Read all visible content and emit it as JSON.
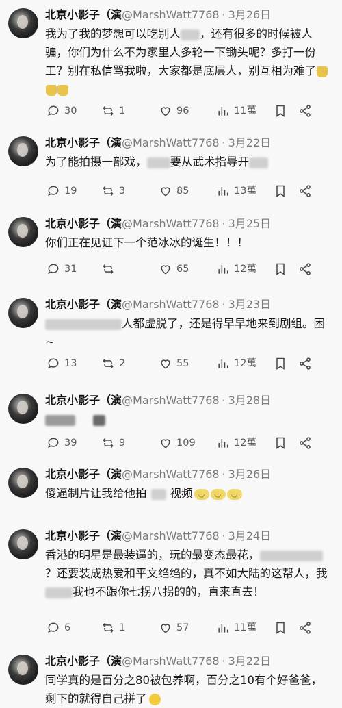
{
  "posts": [
    {
      "name": "北京小影子（演",
      "handle": "@MarshWatt7768",
      "date": "3月26日",
      "text_parts": [
        "我为了我的梦想可以吃别人",
        "，还有很多的时候被人骗，你们为什么不为家里人多轮一下锄头呢？多打一份工？别在私信骂我啦，大家都是底层人，别互相为难了"
      ],
      "replies": "30",
      "reposts": "1",
      "likes": "96",
      "views": "11萬"
    },
    {
      "name": "北京小影子（演",
      "handle": "@MarshWatt7768",
      "date": "3月22日",
      "text_parts": [
        "为了能拍摄一部戏，",
        "要从武术指导开"
      ],
      "replies": "19",
      "reposts": "3",
      "likes": "85",
      "views": "13萬"
    },
    {
      "name": "北京小影子（演",
      "handle": "@MarshWatt7768",
      "date": "3月25日",
      "text_parts": [
        "你们正在见证下一个范冰冰的诞生！！！"
      ],
      "replies": "31",
      "reposts": "",
      "likes": "65",
      "views": "12萬"
    },
    {
      "name": "北京小影子（演",
      "handle": "@MarshWatt7768",
      "date": "3月23日",
      "text_parts": [
        "人都虚脱了，还是得早早地来到剧组。困~"
      ],
      "replies": "13",
      "reposts": "2",
      "likes": "55",
      "views": "12萬"
    },
    {
      "name": "北京小影子（演",
      "handle": "@MarshWatt7768",
      "date": "3月28日",
      "text_parts": [],
      "replies": "39",
      "reposts": "9",
      "likes": "109",
      "views": "12萬"
    },
    {
      "name": "北京小影子（演",
      "handle": "@MarshWatt7768",
      "date": "3月26日",
      "text_parts": [
        "傻逼制片让我给他拍",
        "视频"
      ]
    },
    {
      "name": "北京小影子（演",
      "handle": "@MarshWatt7768",
      "date": "3月24日",
      "text_parts": [
        "香港的明星是最装逼的，玩的最变态最花，",
        "？还要装成热爱和平文绉绉的，真不如大陆的这帮人，我",
        "我也不跟你七拐八拐的的，直来直去！"
      ],
      "replies": "6",
      "reposts": "1",
      "likes": "57",
      "views": "11萬"
    },
    {
      "name": "北京小影子（演",
      "handle": "@MarshWatt7768",
      "date": "3月22日",
      "text_parts": [
        "同学真的是百分之80被包养啊，百分之10有个好爸爸，剩下的就得自己拼了"
      ]
    }
  ],
  "icons": {
    "reply": "comment-bubble-icon",
    "repost": "repost-arrows-icon",
    "like": "heart-icon",
    "views": "bar-chart-icon",
    "save": "bookmark-icon",
    "share": "share-icon"
  }
}
